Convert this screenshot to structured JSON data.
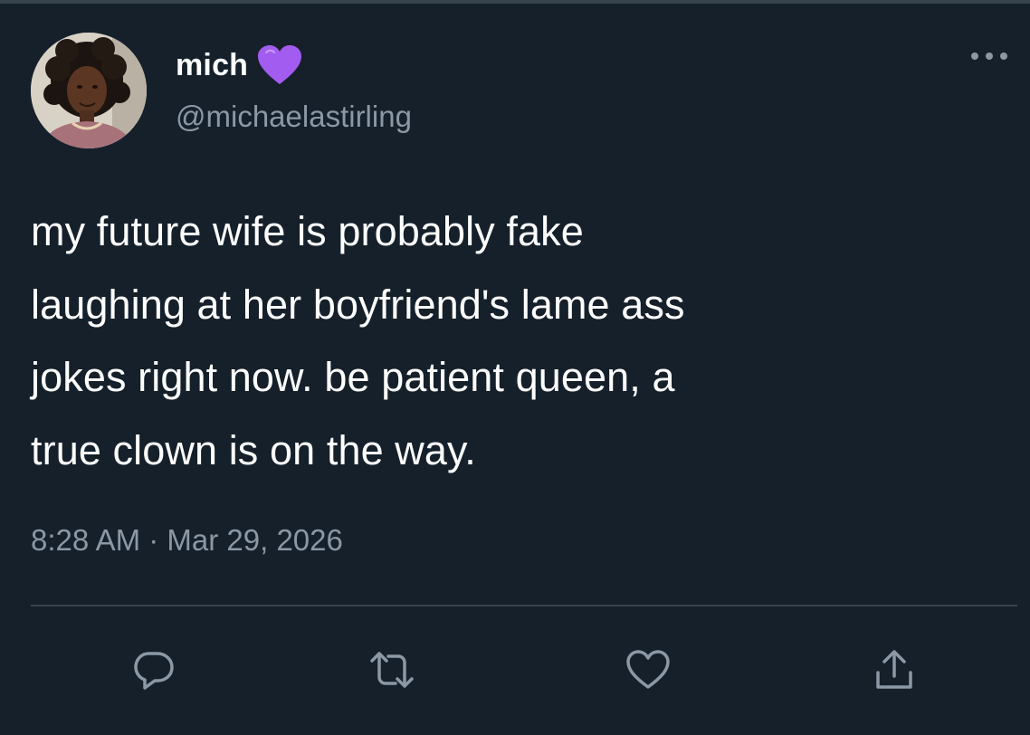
{
  "tweet": {
    "author": {
      "display_name": "mich",
      "emoji": "purple-heart",
      "handle": "@michaelastirling"
    },
    "text": "my future wife is probably fake\nlaughing at her boyfriend's lame ass\njokes right now. be patient queen, a\ntrue clown is on the way.",
    "timestamp": "8:28 AM · Mar 29, 2026"
  },
  "actions": [
    {
      "name": "reply",
      "icon": "speech-bubble-icon"
    },
    {
      "name": "retweet",
      "icon": "retweet-icon"
    },
    {
      "name": "like",
      "icon": "heart-outline-icon"
    },
    {
      "name": "share",
      "icon": "share-upload-icon"
    }
  ],
  "colors": {
    "background": "#15202b",
    "text_primary": "#ffffff",
    "text_secondary": "#8b98a5",
    "divider": "#38444d",
    "emoji_purple": "#a35cf0"
  }
}
